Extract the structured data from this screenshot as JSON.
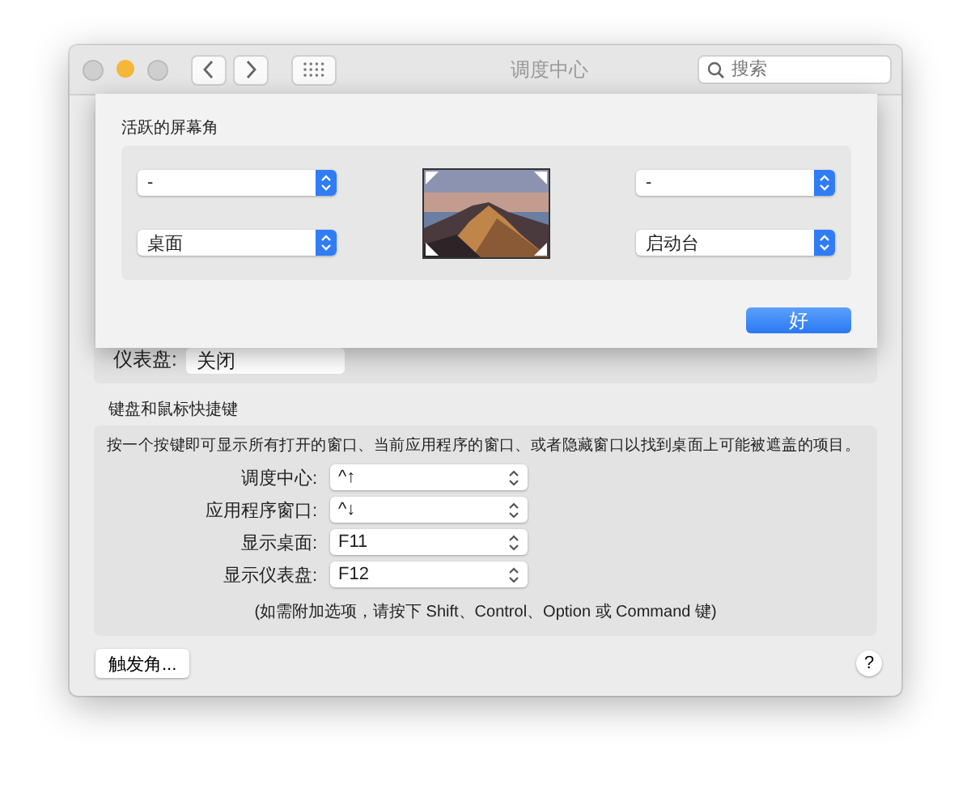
{
  "window": {
    "title": "调度中心",
    "search": {
      "placeholder": "搜索"
    }
  },
  "background_row": {
    "label": "仪表盘:",
    "value": "关闭"
  },
  "shortcuts": {
    "title": "键盘和鼠标快捷键",
    "description": "按一个按键即可显示所有打开的窗口、当前应用程序的窗口、或者隐藏窗口以找到桌面上可能被遮盖的项目。",
    "rows": [
      {
        "label": "调度中心:",
        "value": "^↑"
      },
      {
        "label": "应用程序窗口:",
        "value": "^↓"
      },
      {
        "label": "显示桌面:",
        "value": "F11"
      },
      {
        "label": "显示仪表盘:",
        "value": "F12"
      }
    ],
    "note": "(如需附加选项，请按下 Shift、Control、Option 或 Command 键)"
  },
  "corners_button": "触发角...",
  "help": "?",
  "sheet": {
    "title": "活跃的屏幕角",
    "corners": [
      {
        "value": "-"
      },
      {
        "value": "-"
      },
      {
        "value": "桌面"
      },
      {
        "value": "启动台"
      }
    ],
    "ok": "好"
  }
}
